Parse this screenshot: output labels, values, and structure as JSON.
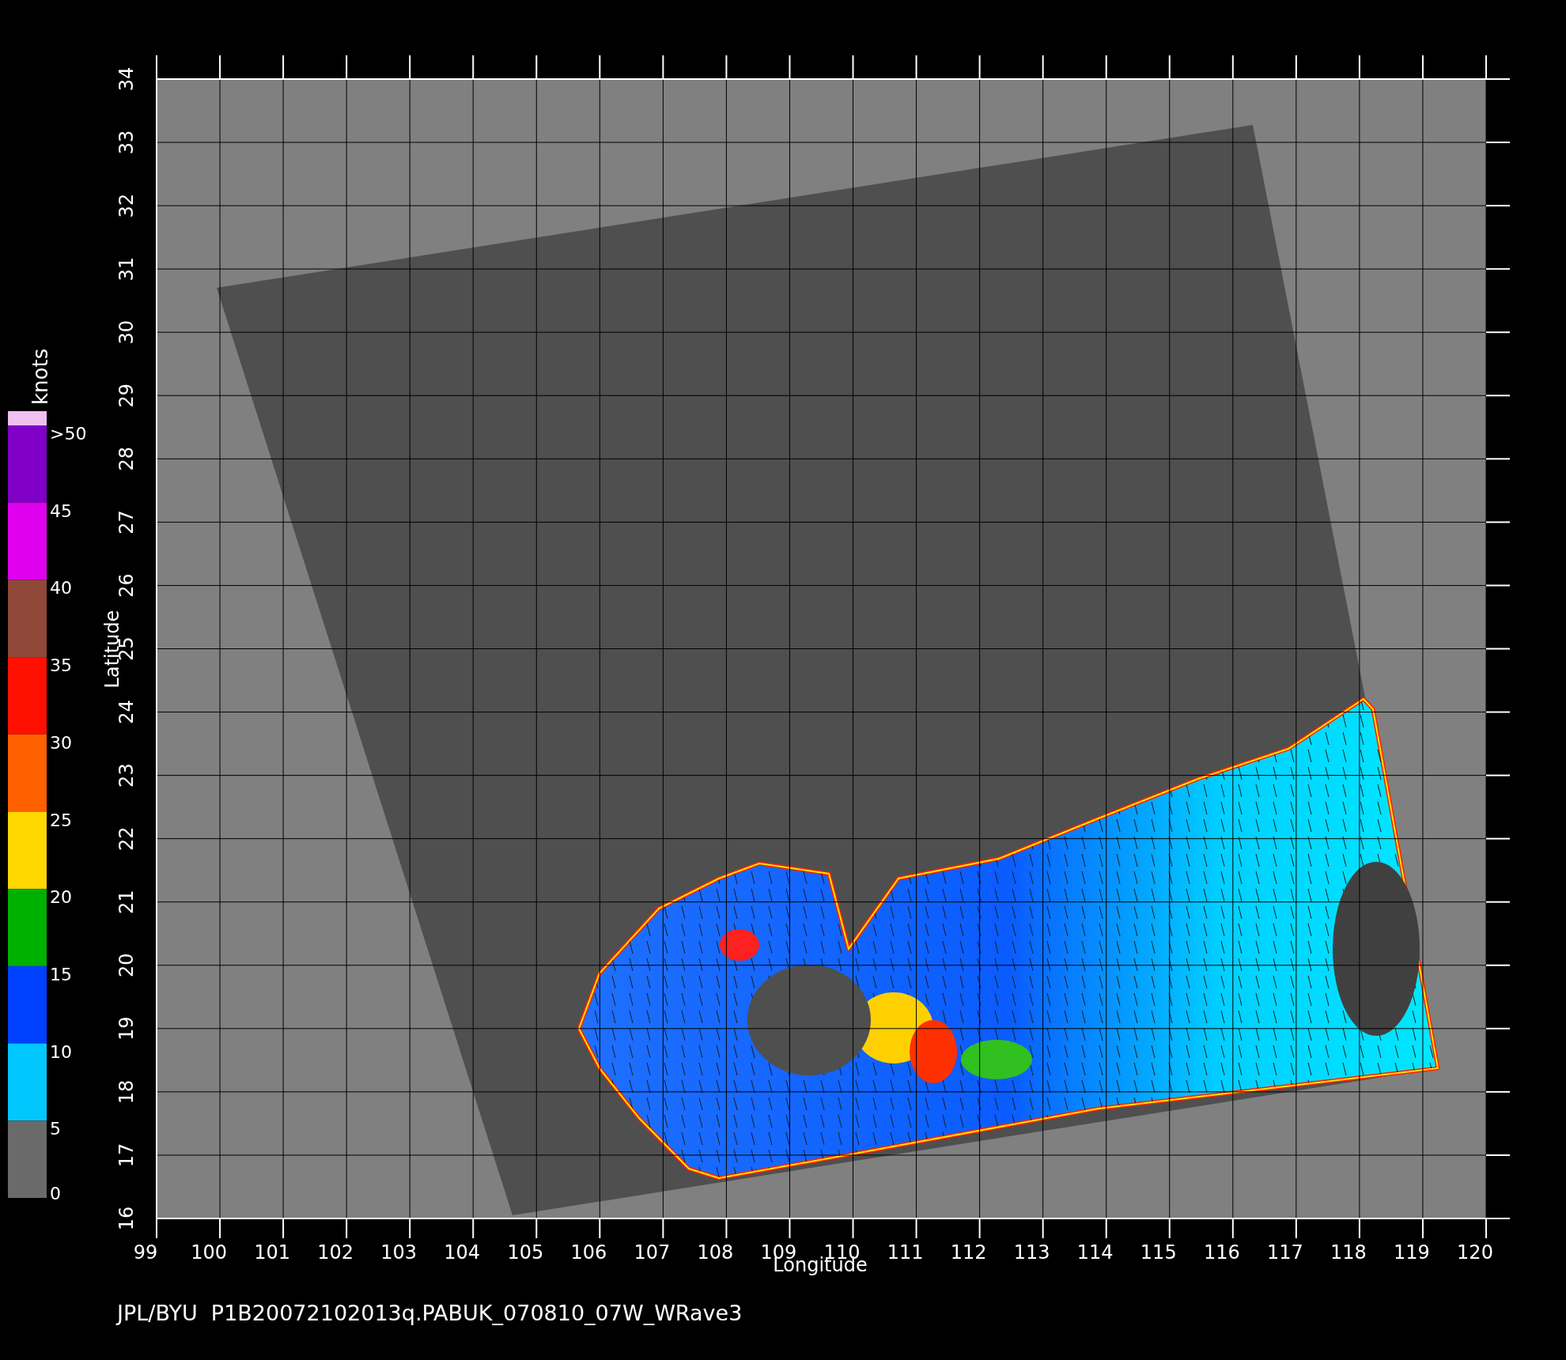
{
  "plot": {
    "x_axis": {
      "label": "Longitude",
      "ticks": [
        "99",
        "100",
        "101",
        "102",
        "103",
        "104",
        "105",
        "106",
        "107",
        "108",
        "109",
        "110",
        "111",
        "112",
        "113",
        "114",
        "115",
        "116",
        "117",
        "118",
        "119",
        "120"
      ]
    },
    "y_axis": {
      "label": "Latitude",
      "ticks": [
        "16",
        "17",
        "18",
        "19",
        "20",
        "21",
        "22",
        "23",
        "24",
        "25",
        "26",
        "27",
        "28",
        "29",
        "30",
        "31",
        "32",
        "33",
        "34"
      ]
    }
  },
  "colorbar": {
    "unit": "knots",
    "bands": [
      {
        "color": "#f0c0f0"
      },
      {
        "color": "#8000c8"
      },
      {
        "color": "#e000f0"
      },
      {
        "color": "#904838"
      },
      {
        "color": "#ff1000"
      },
      {
        "color": "#ff6000"
      },
      {
        "color": "#ffd800"
      },
      {
        "color": "#00b000"
      },
      {
        "color": "#0040ff"
      },
      {
        "color": "#00c8ff"
      },
      {
        "color": "#6a6a6a"
      }
    ],
    "tick_labels": [
      ">50",
      "45",
      "40",
      "35",
      "30",
      "25",
      "20",
      "15",
      "10",
      "5",
      "0"
    ]
  },
  "footer": "JPL/BYU  P1B20072102013q.PABUK_070810_07W_WRave3"
}
